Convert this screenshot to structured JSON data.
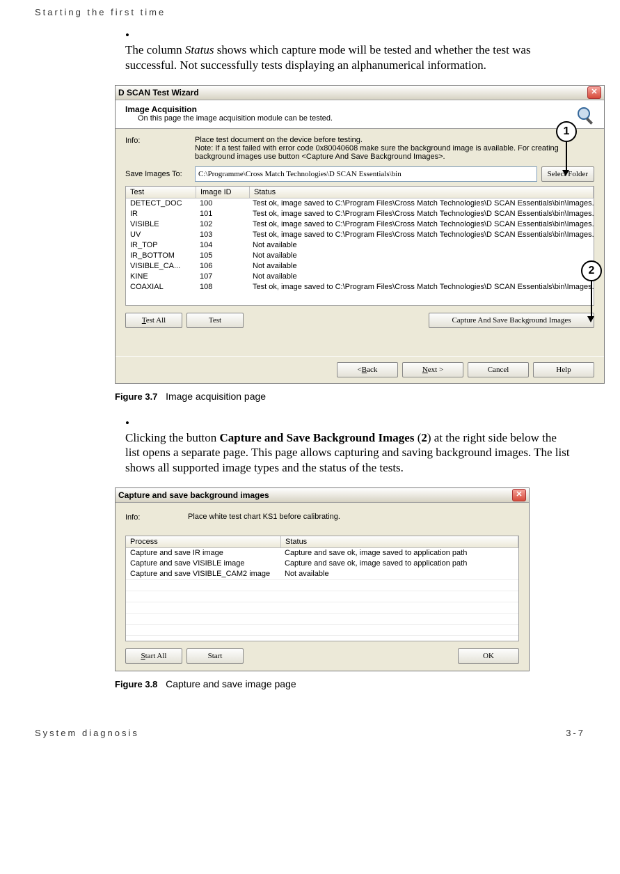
{
  "header": {
    "running": "Starting the first time"
  },
  "para1": {
    "pre": "The column ",
    "em": "Status",
    "post": " shows which capture mode will be tested and whether the test was successful. Not successfully tests displaying an alphanumerical information."
  },
  "fig7": {
    "title": "D SCAN Test Wizard",
    "hdr": {
      "h1": "Image Acquisition",
      "h2": "On this page the image acquisition module can be tested."
    },
    "info_label": "Info:",
    "info_text": "Place test document on the device before testing.\nNote: If a test failed with error code 0x80040608 make sure the background image is available. For creating background images use button <Capture And Save Background Images>.",
    "save_label": "Save Images To:",
    "path": "C:\\Programme\\Cross Match Technologies\\D SCAN Essentials\\bin",
    "select_btn": "Select Folder",
    "cols": {
      "c1": "Test",
      "c2": "Image ID",
      "c3": "Status"
    },
    "rows": [
      {
        "t": "DETECT_DOC",
        "i": "100",
        "s": "Test ok, image saved to C:\\Program Files\\Cross Match Technologies\\D SCAN Essentials\\bin\\Images..."
      },
      {
        "t": "IR",
        "i": "101",
        "s": "Test ok, image saved to C:\\Program Files\\Cross Match Technologies\\D SCAN Essentials\\bin\\Images..."
      },
      {
        "t": "VISIBLE",
        "i": "102",
        "s": "Test ok, image saved to C:\\Program Files\\Cross Match Technologies\\D SCAN Essentials\\bin\\Images..."
      },
      {
        "t": "UV",
        "i": "103",
        "s": "Test ok, image saved to C:\\Program Files\\Cross Match Technologies\\D SCAN Essentials\\bin\\Images..."
      },
      {
        "t": "IR_TOP",
        "i": "104",
        "s": "Not available"
      },
      {
        "t": "IR_BOTTOM",
        "i": "105",
        "s": "Not available"
      },
      {
        "t": "VISIBLE_CA...",
        "i": "106",
        "s": "Not available"
      },
      {
        "t": "KINE",
        "i": "107",
        "s": "Not available"
      },
      {
        "t": "COAXIAL",
        "i": "108",
        "s": "Test ok, image saved to C:\\Program Files\\Cross Match Technologies\\D SCAN Essentials\\bin\\Images..."
      }
    ],
    "btns": {
      "test_all": "Test All",
      "test": "Test",
      "capture": "Capture And Save Background Images",
      "back": "< Back",
      "next": "Next >",
      "cancel": "Cancel",
      "help": "Help"
    },
    "callout1": "1",
    "callout2": "2",
    "caption_b": "Figure 3.7",
    "caption": "Image acquisition page"
  },
  "para2": {
    "pre": "Clicking the button ",
    "bold": "Capture and Save Background Images",
    "mid": " (",
    "bnum": "2",
    "post": ") at the right side below the list opens a separate page. This page allows capturing and saving background images. The list shows all supported image types and the status of the tests."
  },
  "fig8": {
    "title": "Capture and save background images",
    "info_label": "Info:",
    "info_text": "Place white test chart KS1 before calibrating.",
    "cols": {
      "c1": "Process",
      "c2": "Status"
    },
    "rows": [
      {
        "p": "Capture and save IR image",
        "s": "Capture and save ok, image saved to application path"
      },
      {
        "p": "Capture and save VISIBLE image",
        "s": "Capture and save ok, image saved to application path"
      },
      {
        "p": "Capture and save VISIBLE_CAM2 image",
        "s": "Not available"
      }
    ],
    "btns": {
      "start_all": "Start All",
      "start": "Start",
      "ok": "OK"
    },
    "caption_b": "Figure 3.8",
    "caption": "Capture and save image page"
  },
  "footer": {
    "left": "System diagnosis",
    "right": "3-7"
  }
}
